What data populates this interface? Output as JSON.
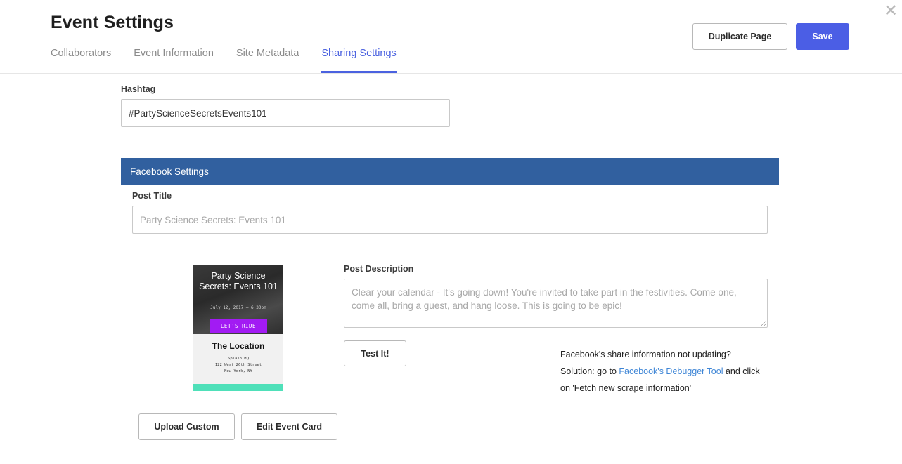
{
  "header": {
    "title": "Event Settings",
    "close_icon": "close-icon",
    "tabs": [
      {
        "label": "Collaborators",
        "active": false
      },
      {
        "label": "Event Information",
        "active": false
      },
      {
        "label": "Site Metadata",
        "active": false
      },
      {
        "label": "Sharing Settings",
        "active": true
      }
    ],
    "duplicate_label": "Duplicate Page",
    "save_label": "Save"
  },
  "hashtag": {
    "label": "Hashtag",
    "value": "#PartyScienceSecretsEvents101"
  },
  "facebook": {
    "section_title": "Facebook Settings",
    "post_title_label": "Post Title",
    "post_title_placeholder": "Party Science Secrets: Events 101",
    "post_description_label": "Post Description",
    "post_description_placeholder": "Clear your calendar - It's going down! You're invited to take part in the festivities. Come one, come all, bring a guest, and hang loose. This is going to be epic!",
    "test_label": "Test It!",
    "help_line1": "Facebook's share information not updating?",
    "help_prefix": "Solution: go to ",
    "help_link": "Facebook's Debugger Tool",
    "help_suffix": " and click on 'Fetch new scrape information'",
    "upload_label": "Upload Custom",
    "edit_card_label": "Edit Event Card"
  },
  "event_card": {
    "title": "Party Science Secrets: Events 101",
    "date": "July 12, 2017 — 6:30pm",
    "cta": "LET'S RIDE",
    "location_title": "The Location",
    "address_lines": [
      "Splash HQ",
      "122 West 26th Street",
      "New York, NY"
    ],
    "cta_color": "#a21bf3",
    "footer_color": "#4fe0b9"
  },
  "colors": {
    "accent": "#4b62e0",
    "facebook_blue": "#31609f",
    "link": "#3f86d6"
  }
}
